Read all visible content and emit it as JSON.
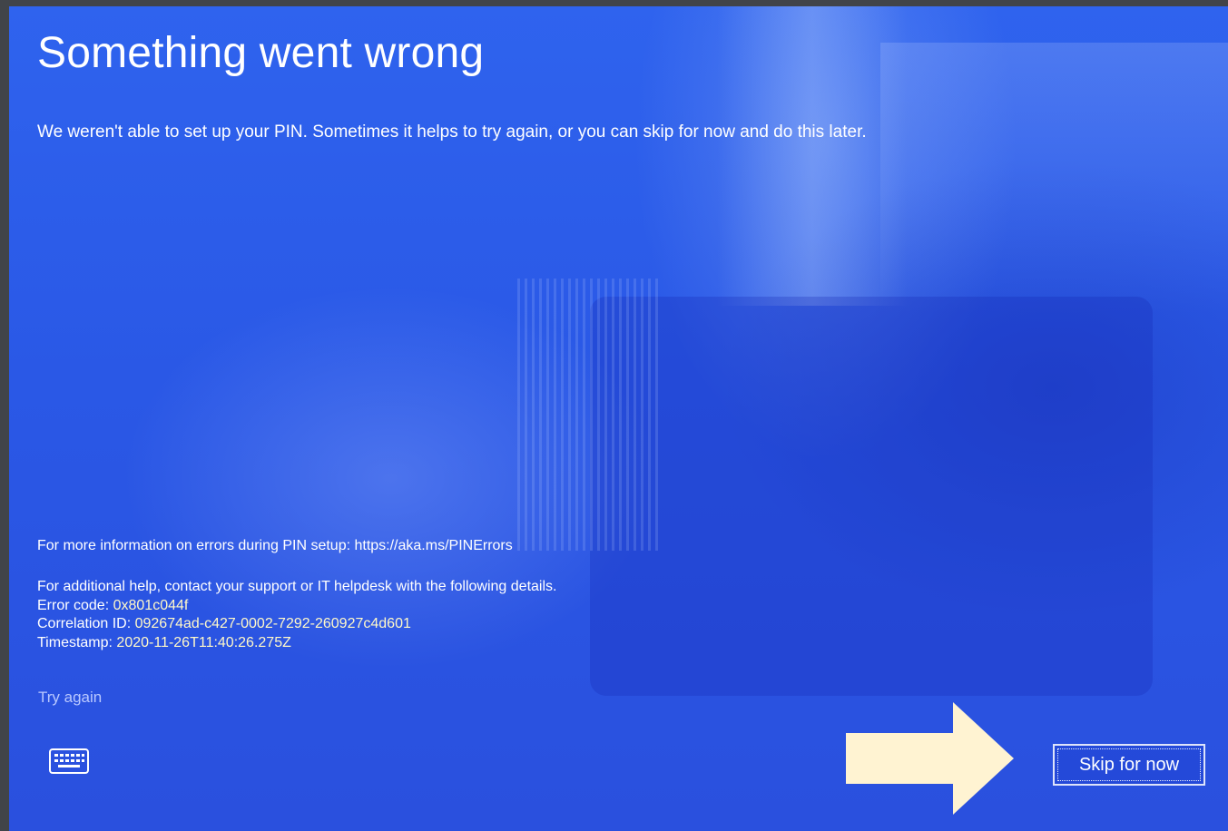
{
  "screen": {
    "title": "Something went wrong",
    "message": "We weren't able to set up your PIN. Sometimes it helps to try again, or you can skip for now and do this later.",
    "more_info": "For more information on errors during PIN setup: https://aka.ms/PINErrors",
    "help_intro": "For additional help, contact your support or IT helpdesk with the following details.",
    "error_code_label": "Error code: ",
    "error_code_value": "0x801c044f",
    "correlation_label": "Correlation ID: ",
    "correlation_value": "092674ad-c427-0002-7292-260927c4d601",
    "timestamp_label": "Timestamp: ",
    "timestamp_value": "2020-11-26T11:40:26.275Z",
    "try_again": "Try again",
    "skip_for_now": "Skip for now",
    "keyboard_icon": "keyboard-icon",
    "annotation_arrow": "right-arrow-icon"
  },
  "colors": {
    "screen_blue": "#2a58e6",
    "text": "#ffffff",
    "link": "#b9c8ff",
    "arrow_fill": "#fff3d2"
  }
}
